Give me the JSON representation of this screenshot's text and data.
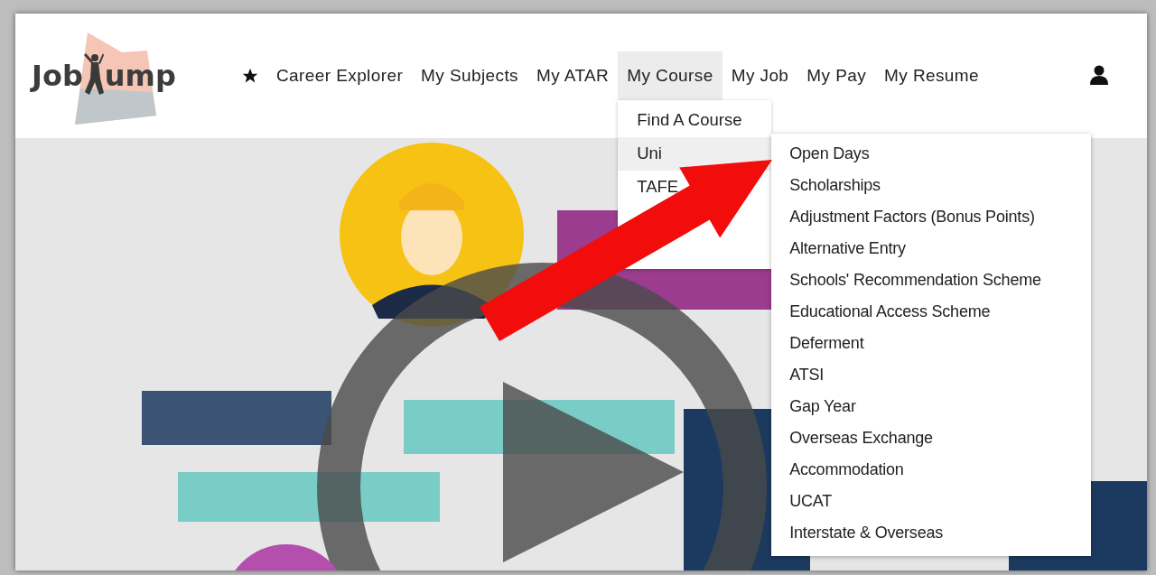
{
  "logo": {
    "text_before": "Job",
    "text_after": "ump"
  },
  "nav": {
    "items": [
      {
        "label": "Career Explorer",
        "selected": false
      },
      {
        "label": "My Subjects",
        "selected": false
      },
      {
        "label": "My ATAR",
        "selected": false
      },
      {
        "label": "My Course",
        "selected": true
      },
      {
        "label": "My Job",
        "selected": false
      },
      {
        "label": "My Pay",
        "selected": false
      },
      {
        "label": "My Resume",
        "selected": false
      }
    ]
  },
  "course_menu": {
    "items": [
      {
        "label": "Find A Course",
        "selected": false
      },
      {
        "label": "Uni",
        "selected": true
      },
      {
        "label": "TAFE",
        "selected": false
      }
    ]
  },
  "uni_submenu": {
    "items": [
      "Open Days",
      "Scholarships",
      "Adjustment Factors (Bonus Points)",
      "Alternative Entry",
      "Schools' Recommendation Scheme",
      "Educational Access Scheme",
      "Deferment",
      "ATSI",
      "Gap Year",
      "Overseas Exchange",
      "Accommodation",
      "UCAT",
      "Interstate & Overseas"
    ]
  }
}
